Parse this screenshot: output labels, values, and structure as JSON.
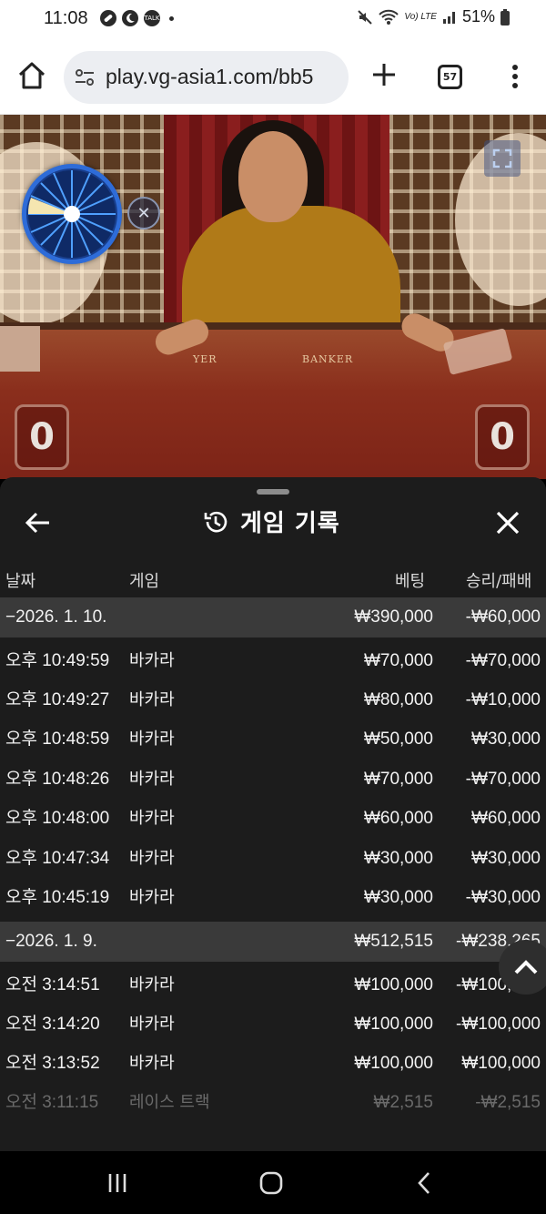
{
  "status_bar": {
    "time": "11:08",
    "icons_left": [
      "pill-icon",
      "moon-icon",
      "talk-icon",
      "dot-icon"
    ],
    "talk_label": "TALK",
    "network_label": "Vo) LTE",
    "battery": "51%"
  },
  "browser": {
    "url": "play.vg-asia1.com/bb5",
    "tab_count": "57"
  },
  "video": {
    "felt_left": "YER",
    "felt_right": "BANKER",
    "player_score": "0",
    "banker_score": "0"
  },
  "sheet": {
    "title": "게임 기록",
    "columns": {
      "date": "날짜",
      "game": "게임",
      "bet": "베팅",
      "result": "승리/패배"
    },
    "groups": [
      {
        "date": "−2026. 1. 10.",
        "bet": "₩390,000",
        "result": "-₩60,000",
        "rows": [
          {
            "time": "오후 10:49:59",
            "game": "바카라",
            "bet": "₩70,000",
            "result": "-₩70,000"
          },
          {
            "time": "오후 10:49:27",
            "game": "바카라",
            "bet": "₩80,000",
            "result": "-₩10,000"
          },
          {
            "time": "오후 10:48:59",
            "game": "바카라",
            "bet": "₩50,000",
            "result": "₩30,000"
          },
          {
            "time": "오후 10:48:26",
            "game": "바카라",
            "bet": "₩70,000",
            "result": "-₩70,000"
          },
          {
            "time": "오후 10:48:00",
            "game": "바카라",
            "bet": "₩60,000",
            "result": "₩60,000"
          },
          {
            "time": "오후 10:47:34",
            "game": "바카라",
            "bet": "₩30,000",
            "result": "₩30,000"
          },
          {
            "time": "오후 10:45:19",
            "game": "바카라",
            "bet": "₩30,000",
            "result": "-₩30,000"
          }
        ]
      },
      {
        "date": "−2026. 1. 9.",
        "bet": "₩512,515",
        "result": "-₩238,265",
        "rows": [
          {
            "time": "오전 3:14:51",
            "game": "바카라",
            "bet": "₩100,000",
            "result": "-₩100,000"
          },
          {
            "time": "오전 3:14:20",
            "game": "바카라",
            "bet": "₩100,000",
            "result": "-₩100,000"
          },
          {
            "time": "오전 3:13:52",
            "game": "바카라",
            "bet": "₩100,000",
            "result": "₩100,000"
          },
          {
            "time": "오전 3:11:15",
            "game": "레이스 트랙",
            "bet": "₩2,515",
            "result": "-₩2,515"
          }
        ]
      }
    ]
  },
  "colors": {
    "sheet_bg": "#1c1c1c",
    "group_bg": "#3a3a3a",
    "wheel_blue": "#2e6cd8"
  }
}
